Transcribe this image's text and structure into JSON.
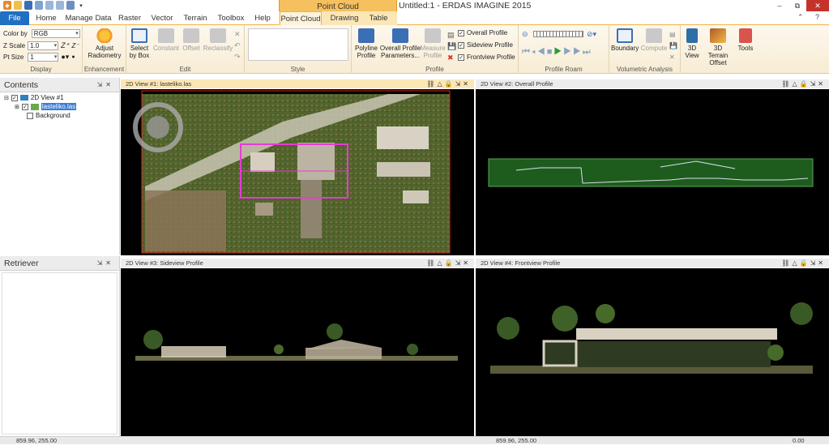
{
  "app": {
    "title": "Untitled:1 - ERDAS IMAGINE 2015",
    "context_tab_title": "Point Cloud"
  },
  "window_controls": {
    "minimize": "–",
    "restore": "⧉",
    "close": "✕"
  },
  "tabs": [
    "File",
    "Home",
    "Manage Data",
    "Raster",
    "Vector",
    "Terrain",
    "Toolbox",
    "Help",
    "Point Cloud",
    "Drawing",
    "Table"
  ],
  "active_tab": "Point Cloud",
  "ribbon": {
    "display": {
      "color_by_label": "Color by",
      "color_by_value": "RGB",
      "z_scale_label": "Z Scale",
      "z_scale_value": "1.0",
      "pt_size_label": "Pt Size",
      "pt_size_value": "1",
      "group_label": "Display"
    },
    "enhancement": {
      "adjust_label_1": "Adjust",
      "adjust_label_2": "Radiometry",
      "group_label": "Enhancement"
    },
    "edit": {
      "select_1": "Select",
      "select_2": "by Box",
      "constant": "Constant",
      "offset": "Offset",
      "reclassify": "Reclassify",
      "group_label": "Edit"
    },
    "style": {
      "group_label": "Style"
    },
    "profile": {
      "polyline_1": "Polyline",
      "polyline_2": "Profile",
      "overall_1": "Overall Profile",
      "overall_2": "Parameters...",
      "measure_1": "Measure",
      "measure_2": "Profile",
      "chk_overall": "Overall Profile",
      "chk_sideview": "Sideview Profile",
      "chk_frontview": "Frontview Profile",
      "group_label": "Profile"
    },
    "profile_roam": {
      "group_label": "Profile Roam"
    },
    "volumetric": {
      "boundary": "Boundary",
      "compute": "Compute",
      "group_label": "Volumetric Analysis"
    },
    "view3d": {
      "label_1": "3D",
      "label_2": "View"
    },
    "terrain": {
      "label_1": "3D Terrain",
      "label_2": "Offset"
    },
    "tools": {
      "label": "Tools"
    }
  },
  "contents_panel": {
    "title": "Contents",
    "items": [
      {
        "label": "2D View #1"
      },
      {
        "label": "lasteliko.las"
      },
      {
        "label": "Background"
      }
    ]
  },
  "retriever_panel": {
    "title": "Retriever"
  },
  "views": [
    {
      "title": "2D View #1: lasteliko.las"
    },
    {
      "title": "2D View #2: Overall Profile"
    },
    {
      "title": "2D View #3: Sideview Profile"
    },
    {
      "title": "2D View #4: Frontview Profile"
    }
  ],
  "status": {
    "left_coords": "859.96, 255.00",
    "mid_coords": "859.96, 255.00",
    "right_value": "0.00"
  }
}
